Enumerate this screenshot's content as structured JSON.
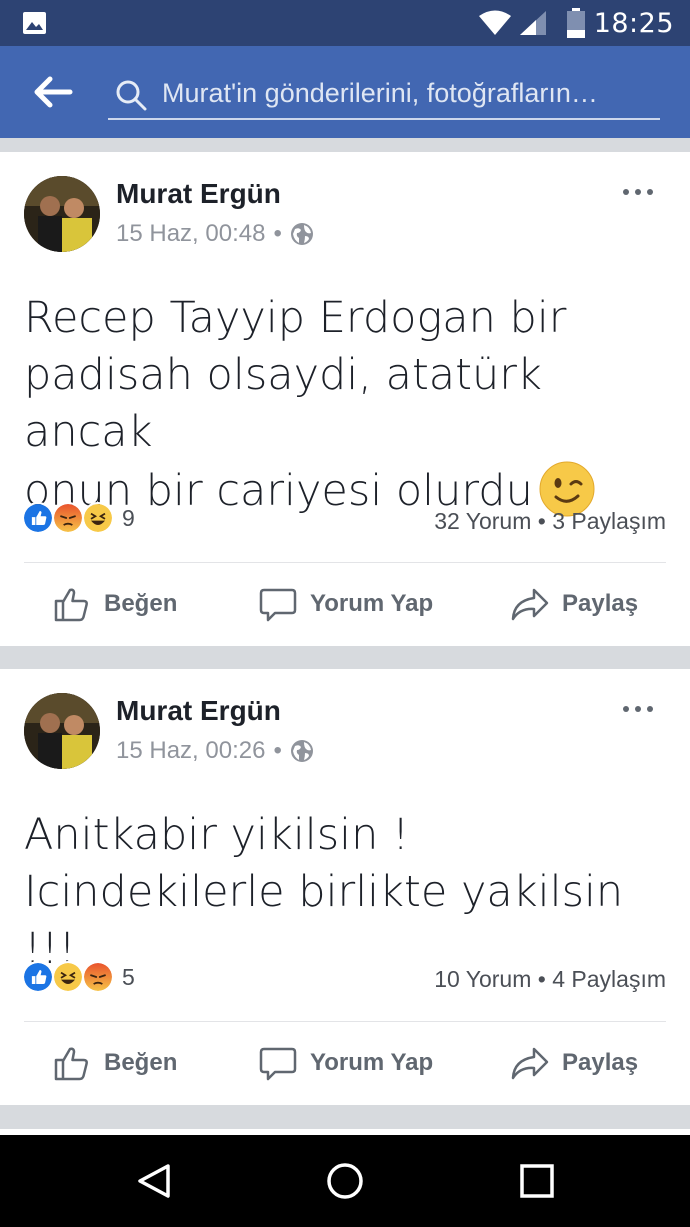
{
  "status_bar": {
    "time": "18:25",
    "icons": [
      "gallery-icon",
      "wifi-icon",
      "signal-icon",
      "battery-icon"
    ]
  },
  "app_bar": {
    "search_placeholder": "Murat'in gönderilerini, fotoğrafların…",
    "accent_color": "#4267b2"
  },
  "posts": [
    {
      "author": "Murat Ergün",
      "date": "15 Haz, 00:48",
      "separator": "•",
      "text_lines": [
        "Recep Tayyip Erdogan bir",
        "padisah olsaydi, atatürk ancak",
        "onun bir cariyesi olurdu"
      ],
      "text_emoji": "wink-emoji",
      "reactions": [
        "like",
        "angry",
        "haha"
      ],
      "reaction_count": "9",
      "comments": "32 Yorum",
      "shares": "3 Paylaşım",
      "stats_separator": "•"
    },
    {
      "author": "Murat Ergün",
      "date": "15 Haz, 00:26",
      "separator": "•",
      "text_lines": [
        "Anitkabir yikilsin !",
        "Icindekilerle birlikte yakilsin !!!"
      ],
      "reactions": [
        "like",
        "haha",
        "angry"
      ],
      "reaction_count": "5",
      "comments": "10 Yorum",
      "shares": "4 Paylaşım",
      "stats_separator": "•"
    }
  ],
  "actions": {
    "like": "Beğen",
    "comment": "Yorum Yap",
    "share": "Paylaş"
  },
  "nav_bar": {
    "buttons": [
      "back-triangle-icon",
      "home-circle-icon",
      "recents-square-icon"
    ]
  }
}
